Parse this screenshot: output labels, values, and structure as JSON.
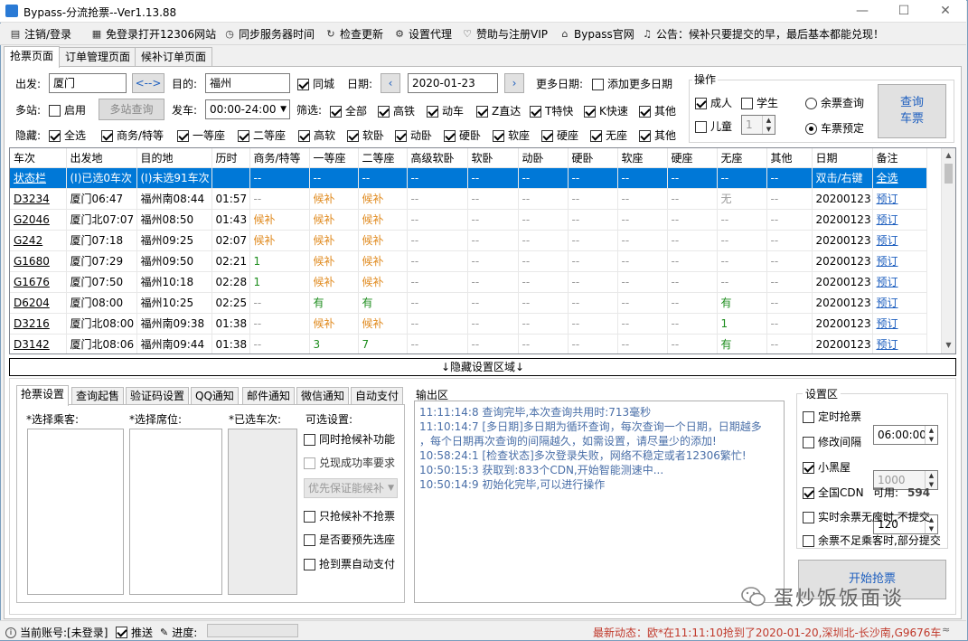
{
  "window": {
    "title": "Bypass-分流抢票--Ver1.13.88"
  },
  "menu": [
    {
      "label": "注销/登录",
      "icon": "monitor-icon"
    },
    {
      "label": "免登录打开12306网站",
      "icon": "browser-icon"
    },
    {
      "label": "同步服务器时间",
      "icon": "clock-icon"
    },
    {
      "label": "检查更新",
      "icon": "refresh-icon"
    },
    {
      "label": "设置代理",
      "icon": "gear-icon"
    },
    {
      "label": "赞助与注册VIP",
      "icon": "heart-icon"
    },
    {
      "label": "Bypass官网",
      "icon": "home-icon"
    },
    {
      "label": "公告：候补只要提交的早，最后基本都能兑现！",
      "icon": "speaker-icon"
    }
  ],
  "tabs": [
    "抢票页面",
    "订单管理页面",
    "候补订单页面"
  ],
  "search": {
    "from_label": "出发:",
    "from_value": "厦门",
    "swap_label": "<-->",
    "to_label": "目的:",
    "to_value": "福州",
    "same_city_label": "同城",
    "date_label": "日期:",
    "date_value": "2020-01-23",
    "more_dates_label": "更多日期:",
    "add_dates_label": "添加更多日期",
    "multi_station_label": "多站:",
    "enable_label": "启用",
    "multi_query_label": "多站查询",
    "depart_label": "发车:",
    "depart_value": "00:00-24:00",
    "filter_label": "筛选:",
    "filters": [
      "全部",
      "高铁",
      "动车",
      "Z直达",
      "T特快",
      "K快速",
      "其他"
    ],
    "hide_label": "隐藏:",
    "hide_options": [
      "全选",
      "商务/特等",
      "一等座",
      "二等座",
      "高软",
      "软卧",
      "动卧",
      "硬卧",
      "软座",
      "硬座",
      "无座",
      "其他"
    ]
  },
  "operation": {
    "title": "操作",
    "adult_label": "成人",
    "student_label": "学生",
    "child_label": "儿童",
    "child_count": "1",
    "remain_query_label": "余票查询",
    "book_label": "车票预定",
    "query_button": "查询\n车票"
  },
  "table": {
    "headers": [
      "车次",
      "出发地",
      "目的地",
      "历时",
      "商务/特等",
      "一等座",
      "二等座",
      "高级软卧",
      "软卧",
      "动卧",
      "硬卧",
      "软座",
      "硬座",
      "无座",
      "其他",
      "日期",
      "备注"
    ],
    "rows": [
      [
        "状态栏",
        "(I)已选0车次",
        "(I)未选91车次",
        "",
        "--",
        "--",
        "--",
        "--",
        "--",
        "--",
        "--",
        "--",
        "--",
        "--",
        "--",
        "双击/右键",
        "全选"
      ],
      [
        "D3234",
        "厦门06:47",
        "福州南08:44",
        "01:57",
        "--",
        "候补",
        "候补",
        "--",
        "--",
        "--",
        "--",
        "--",
        "--",
        "无",
        "--",
        "20200123",
        "预订"
      ],
      [
        "G2046",
        "厦门北07:07",
        "福州08:50",
        "01:43",
        "候补",
        "候补",
        "候补",
        "--",
        "--",
        "--",
        "--",
        "--",
        "--",
        "--",
        "--",
        "20200123",
        "预订"
      ],
      [
        "G242",
        "厦门07:18",
        "福州09:25",
        "02:07",
        "候补",
        "候补",
        "候补",
        "--",
        "--",
        "--",
        "--",
        "--",
        "--",
        "--",
        "--",
        "20200123",
        "预订"
      ],
      [
        "G1680",
        "厦门07:29",
        "福州09:50",
        "02:21",
        "1",
        "候补",
        "候补",
        "--",
        "--",
        "--",
        "--",
        "--",
        "--",
        "--",
        "--",
        "20200123",
        "预订"
      ],
      [
        "G1676",
        "厦门07:50",
        "福州10:18",
        "02:28",
        "1",
        "候补",
        "候补",
        "--",
        "--",
        "--",
        "--",
        "--",
        "--",
        "--",
        "--",
        "20200123",
        "预订"
      ],
      [
        "D6204",
        "厦门08:00",
        "福州10:25",
        "02:25",
        "--",
        "有",
        "有",
        "--",
        "--",
        "--",
        "--",
        "--",
        "--",
        "有",
        "--",
        "20200123",
        "预订"
      ],
      [
        "D3216",
        "厦门北08:00",
        "福州南09:38",
        "01:38",
        "--",
        "候补",
        "候补",
        "--",
        "--",
        "--",
        "--",
        "--",
        "--",
        "1",
        "--",
        "20200123",
        "预订"
      ],
      [
        "D3142",
        "厦门北08:06",
        "福州南09:44",
        "01:38",
        "--",
        "3",
        "7",
        "--",
        "--",
        "--",
        "--",
        "--",
        "--",
        "有",
        "--",
        "20200123",
        "预订"
      ]
    ]
  },
  "hide_settings_bar": "↓隐藏设置区域↓",
  "bottom_tabs": [
    "抢票设置",
    "查询起售",
    "验证码设置",
    "QQ通知",
    "邮件通知",
    "微信通知",
    "自动支付"
  ],
  "ticket_settings": {
    "passenger_label": "*选择乘客:",
    "seat_label": "*选择席位:",
    "selected_trains_label": "*已选车次:",
    "optional_label": "可选设置:",
    "options": [
      "同时抢候补功能",
      "兑现成功率要求",
      "只抢候补不抢票",
      "是否要预先选座",
      "抢到票自动支付"
    ],
    "priority_value": "优先保证能候补"
  },
  "output": {
    "title": "输出区",
    "lines": [
      "11:11:14:8  查询完毕,本次查询共用时:713毫秒",
      "11:10:14:7  [多日期]多日期为循环查询，每次查询一个日期，日期越多",
      "      ，每个日期再次查询的间隔越久，如需设置，请尽量少的添加!",
      "10:58:24:1  [检查状态]多次登录失败，网络不稳定或者12306繁忙!",
      "10:50:15:3  获取到:833个CDN,开始智能测速中...",
      "10:50:14:9  初始化完毕,可以进行操作"
    ]
  },
  "settings": {
    "title": "设置区",
    "timed_label": "定时抢票",
    "timed_value": "06:00:00",
    "interval_label": "修改间隔",
    "interval_value": "1000",
    "blackroom_label": "小黑屋",
    "blackroom_value": "120",
    "cdn_label": "全国CDN",
    "cdn_available_label": "可用:",
    "cdn_available_value": "594",
    "no_seat_label": "实时余票无座时,不提交",
    "partial_label": "余票不足乘客时,部分提交",
    "start_button": "开始抢票"
  },
  "statusbar": {
    "account_label": "当前账号:[未登录]",
    "push_label": "推送",
    "progress_label": "进度:",
    "news": "最新动态：欧*在11:11:10抢到了2020-01-20,深圳北-长沙南,G9676车"
  },
  "watermark": "蛋炒饭饭面谈",
  "colors": {
    "selection": "#0078d7",
    "waitlist": "#e08a1e",
    "available": "#1c8c1c",
    "news": "#c0392b"
  }
}
